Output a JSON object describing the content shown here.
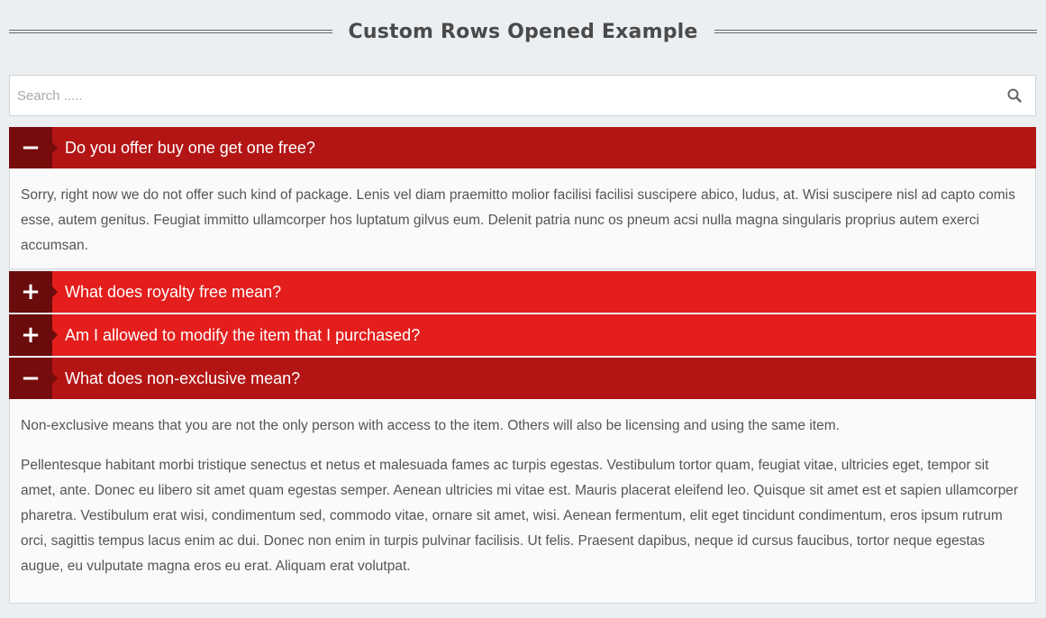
{
  "page": {
    "title": "Custom Rows Opened Example"
  },
  "search": {
    "placeholder": "Search .....",
    "icon": "search-icon"
  },
  "accordion": {
    "items": [
      {
        "question": "Do you offer buy one get one free?",
        "state": "open",
        "toggle": "−",
        "answer": [
          "Sorry, right now we do not offer such kind of package. Lenis vel diam praemitto molior facilisi facilisi suscipere abico, ludus, at. Wisi suscipere nisl ad capto comis esse, autem genitus. Feugiat immitto ullamcorper hos luptatum gilvus eum. Delenit patria nunc os pneum acsi nulla magna singularis proprius autem exerci accumsan."
        ]
      },
      {
        "question": "What does royalty free mean?",
        "state": "closed",
        "toggle": "+"
      },
      {
        "question": "Am I allowed to modify the item that I purchased?",
        "state": "closed",
        "toggle": "+"
      },
      {
        "question": "What does non-exclusive mean?",
        "state": "open",
        "toggle": "−",
        "answer": [
          "Non-exclusive means that you are not the only person with access to the item. Others will also be licensing and using the same item.",
          "Pellentesque habitant morbi tristique senectus et netus et malesuada fames ac turpis egestas. Vestibulum tortor quam, feugiat vitae, ultricies eget, tempor sit amet, ante. Donec eu libero sit amet quam egestas semper. Aenean ultricies mi vitae est. Mauris placerat eleifend leo. Quisque sit amet est et sapien ullamcorper pharetra. Vestibulum erat wisi, condimentum sed, commodo vitae, ornare sit amet, wisi. Aenean fermentum, elit eget tincidunt condimentum, eros ipsum rutrum orci, sagittis tempus lacus enim ac dui. Donec non enim in turpis pulvinar facilisis. Ut felis. Praesent dapibus, neque id cursus faucibus, tortor neque egestas augue, eu vulputate magna eros eu erat. Aliquam erat volutpat."
        ]
      }
    ]
  },
  "colors": {
    "open_header": "#b31515",
    "closed_header": "#e31e1c",
    "toggle_box": "#760c0c",
    "background": "#eceff2"
  }
}
